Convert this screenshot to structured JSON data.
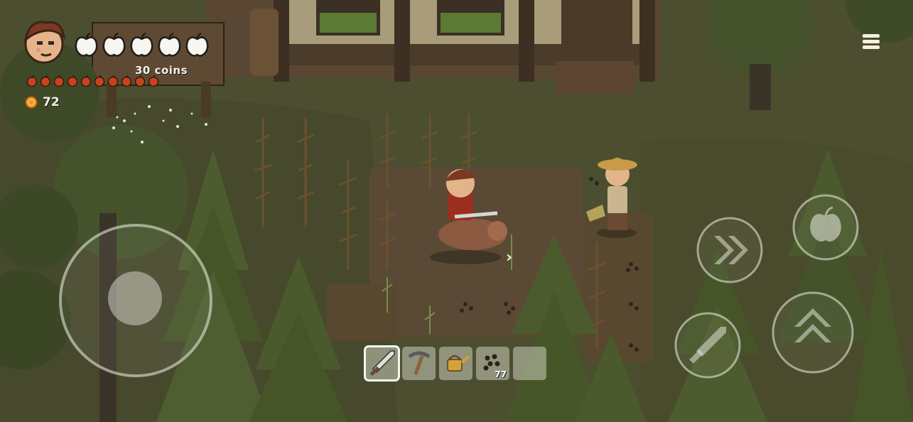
{
  "hud": {
    "hearts": {
      "filled": 5,
      "total": 5,
      "icon": "apple-heart-icon"
    },
    "hunger": {
      "filled": 10,
      "total": 10
    },
    "coins": "72",
    "coin_pickup_text": "30 coins"
  },
  "hotbar": {
    "selected_index": 0,
    "slots": [
      {
        "item": "sword",
        "icon": "sword-icon",
        "count": ""
      },
      {
        "item": "pickaxe",
        "icon": "pickaxe-icon",
        "count": ""
      },
      {
        "item": "watering-can",
        "icon": "watering-can-icon",
        "count": ""
      },
      {
        "item": "seeds",
        "icon": "seeds-icon",
        "count": "77"
      },
      {
        "item": "",
        "icon": "",
        "count": ""
      }
    ]
  },
  "controls": {
    "menu": "menu-icon",
    "joystick": "virtual-joystick",
    "dash": "dash-icon",
    "eat": "apple-icon",
    "attack": "sword-icon",
    "jump": "jump-icon"
  },
  "colors": {
    "grass": "#4b4e2f",
    "dirt": "#5a4a35",
    "tree": "#3f4a27",
    "ui_white": "#f4f0e2",
    "hunger": "#c8431c",
    "coin": "#e7962a"
  }
}
